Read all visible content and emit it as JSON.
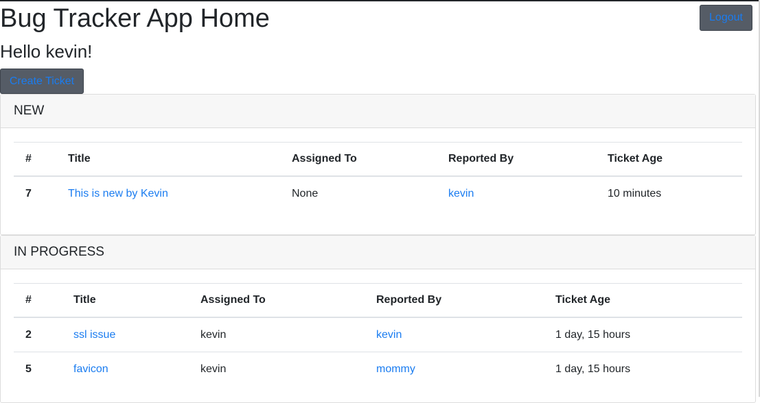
{
  "header": {
    "title": "Bug Tracker App Home",
    "greeting": "Hello kevin!",
    "logout_label": "Logout",
    "create_ticket_label": "Create Ticket"
  },
  "sections": {
    "new": {
      "title": "NEW",
      "columns": [
        "#",
        "Title",
        "Assigned To",
        "Reported By",
        "Ticket Age"
      ],
      "rows": [
        {
          "id": "7",
          "title": "This is new by Kevin",
          "assigned_to": "None",
          "reported_by": "kevin",
          "age": "10 minutes"
        }
      ]
    },
    "in_progress": {
      "title": "IN PROGRESS",
      "columns": [
        "#",
        "Title",
        "Assigned To",
        "Reported By",
        "Ticket Age"
      ],
      "rows": [
        {
          "id": "2",
          "title": "ssl issue",
          "assigned_to": "kevin",
          "reported_by": "kevin",
          "age": "1 day, 15 hours"
        },
        {
          "id": "5",
          "title": "favicon",
          "assigned_to": "kevin",
          "reported_by": "mommy",
          "age": "1 day, 15 hours"
        }
      ]
    }
  },
  "colors": {
    "button_bg": "#555c66",
    "link": "#1a7cf0",
    "text": "#212529",
    "card_header_bg": "#f7f7f7"
  }
}
